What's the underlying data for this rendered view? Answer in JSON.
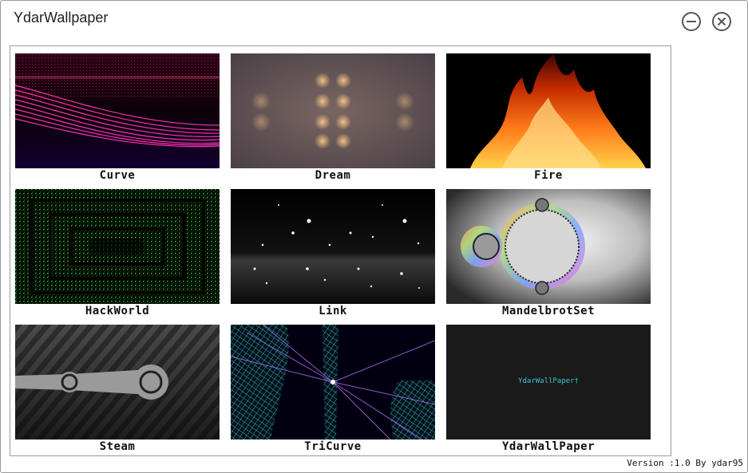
{
  "window": {
    "title": "YdarWallpaper",
    "minimize_icon": "minus-circle-icon",
    "close_icon": "x-circle-icon"
  },
  "wallpapers": [
    {
      "label": "Curve"
    },
    {
      "label": "Dream"
    },
    {
      "label": "Fire"
    },
    {
      "label": "HackWorld"
    },
    {
      "label": "Link"
    },
    {
      "label": "MandelbrotSet"
    },
    {
      "label": "Steam"
    },
    {
      "label": "TriCurve"
    },
    {
      "label": "YdarWallPaper",
      "preview_text": "YdarWallPaper†"
    }
  ],
  "footer": {
    "version": "Version :1.0 By ydar95"
  },
  "colors": {
    "accent_pink": "#ff2fb0",
    "hack_green": "#33cc33",
    "preview_cyan": "#38c8d8"
  }
}
